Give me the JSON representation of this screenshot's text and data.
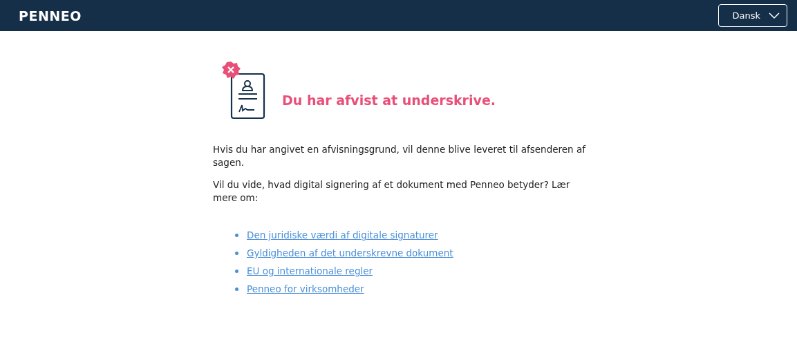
{
  "header": {
    "logo": "PENNEO",
    "language": {
      "label": "Dansk",
      "expanded": false
    }
  },
  "title": "Du har afvist at underskrive.",
  "paragraphs": [
    "Hvis du har angivet en afvisningsgrund, vil denne blive leveret til afsenderen af sagen.",
    "Vil du vide, hvad digital signering af et dokument med Penneo betyder? Lær mere om:"
  ],
  "links": [
    "Den juridiske værdi af digitale signaturer",
    "Gyldigheden af det underskrevne dokument",
    "EU og internationale regler",
    "Penneo for virksomheder"
  ]
}
